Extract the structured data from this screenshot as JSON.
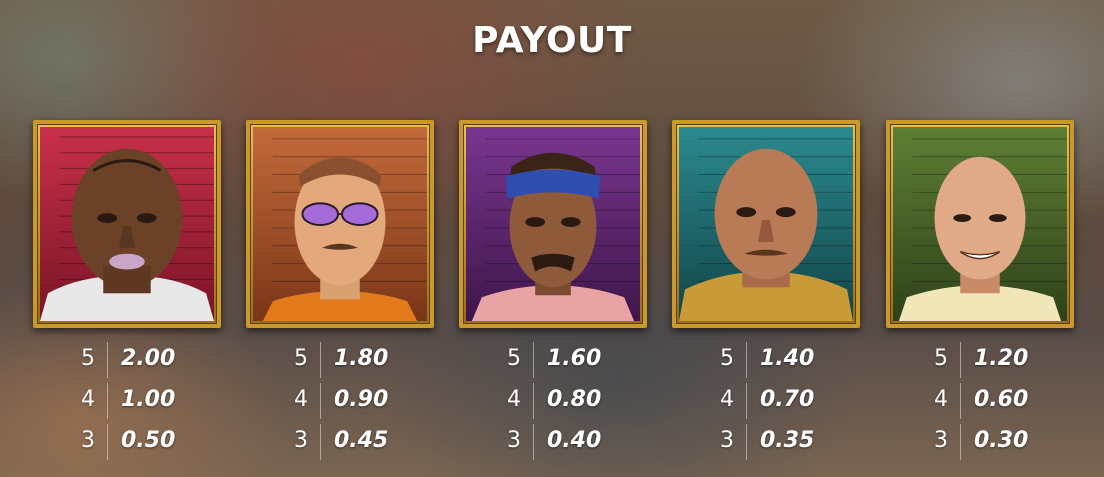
{
  "title": "PAYOUT",
  "symbols": [
    {
      "name": "red-background-inmate",
      "background_color": "#b0263c",
      "tattoo_text": "",
      "payouts": [
        {
          "count": "5",
          "value": "2.00"
        },
        {
          "count": "4",
          "value": "1.00"
        },
        {
          "count": "3",
          "value": "0.50"
        }
      ]
    },
    {
      "name": "orange-background-inmate",
      "background_color": "#b0582e",
      "tattoo_text": "",
      "payouts": [
        {
          "count": "5",
          "value": "1.80"
        },
        {
          "count": "4",
          "value": "0.90"
        },
        {
          "count": "3",
          "value": "0.45"
        }
      ]
    },
    {
      "name": "purple-background-inmate",
      "background_color": "#6a2a78",
      "tattoo_text": "",
      "payouts": [
        {
          "count": "5",
          "value": "1.60"
        },
        {
          "count": "4",
          "value": "0.80"
        },
        {
          "count": "3",
          "value": "0.40"
        }
      ]
    },
    {
      "name": "teal-background-inmate",
      "background_color": "#1d6e73",
      "tattoo_text": "",
      "payouts": [
        {
          "count": "5",
          "value": "1.40"
        },
        {
          "count": "4",
          "value": "0.70"
        },
        {
          "count": "3",
          "value": "0.35"
        }
      ]
    },
    {
      "name": "green-background-inmate",
      "background_color": "#4d6a2a",
      "tattoo_text": "",
      "payouts": [
        {
          "count": "5",
          "value": "1.20"
        },
        {
          "count": "4",
          "value": "0.60"
        },
        {
          "count": "3",
          "value": "0.30"
        }
      ]
    }
  ],
  "colors": {
    "frame_gold": "#c99a2a",
    "text": "#ffffff"
  }
}
